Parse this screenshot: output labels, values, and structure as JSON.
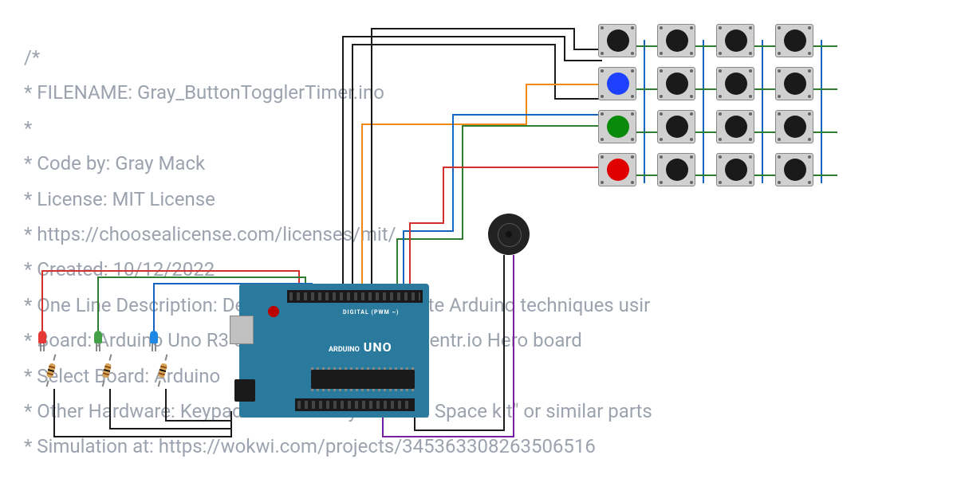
{
  "code": {
    "lines": [
      "/*",
      " * FILENAME: Gray_ButtonTogglerTimer.ino",
      " *",
      " * Code by: Gray Mack",
      " * License: MIT License",
      " *          https://choosealicense.com/licenses/mit/",
      " * Created: 10/12/2022",
      " * One Line Description: Demonstrate intermediate Arduino techniques usir",
      " * Board: Arduino Uno R3 compatible such as Inventr.io Hero board",
      " * Select Board: Arduino",
      " * Other Hardware: Keypad from \"30 Days Lost In Space kit\" or similar parts",
      " * Simulation at: https://wokwi.com/projects/345363308263506516"
    ]
  },
  "arduino": {
    "brand": "ARDUINO",
    "model": "UNO",
    "digital_label": "DIGITAL (PWM ~)",
    "color": "#2a7a9e"
  },
  "leds": [
    {
      "name": "red-led",
      "color": "#e53935"
    },
    {
      "name": "green-led",
      "color": "#43a047"
    },
    {
      "name": "blue-led",
      "color": "#1e88e5"
    }
  ],
  "buzzer": {
    "name": "piezo-buzzer"
  },
  "keypad": {
    "rows": 4,
    "cols": 4,
    "special_buttons": {
      "r1c0": {
        "color": "#1e40ff",
        "name": "blue-key"
      },
      "r2c0": {
        "color": "#0a8a0a",
        "name": "green-key"
      },
      "r3c0": {
        "color": "#e10000",
        "name": "red-key"
      }
    }
  },
  "wires": {
    "colors": {
      "black": "#1a1a1a",
      "red": "#d32f2f",
      "green": "#2e7d32",
      "blue": "#1565c0",
      "orange": "#ef8a17",
      "purple": "#7b1fa2"
    }
  }
}
